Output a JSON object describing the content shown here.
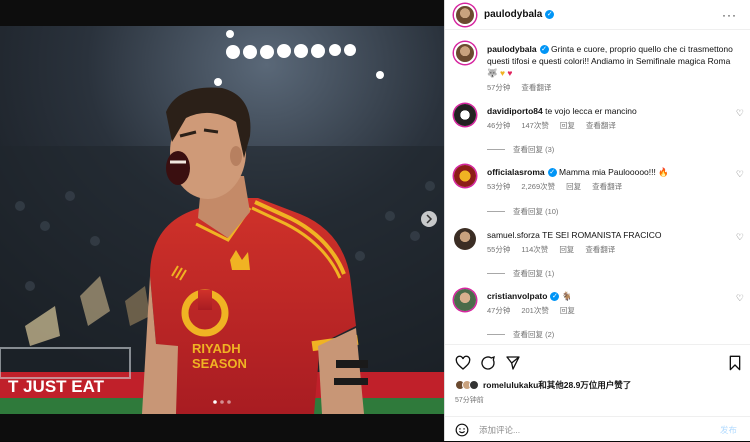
{
  "header": {
    "username": "paulodybala",
    "more_label": "···"
  },
  "caption": {
    "username": "paulodybala",
    "text": "Grinta e cuore, proprio quello che ci trasmettono questi tifosi e questi colori!! Andiamo in Semifinale magica Roma",
    "time": "57分钟",
    "translate": "查看翻译"
  },
  "comments": [
    {
      "username": "davidiporto84",
      "text": "te vojo lecca er mancino",
      "time": "46分钟",
      "likes": "147次赞",
      "reply": "回复",
      "translate": "查看翻译",
      "replies": "查看回复 (3)"
    },
    {
      "username": "officialasroma",
      "text": "Mamma mia Paulooooo!!! 🔥",
      "time": "53分钟",
      "likes": "2,269次赞",
      "reply": "回复",
      "translate": "查看翻译",
      "replies": "查看回复 (10)"
    },
    {
      "username": "samuel.sforza",
      "text": "TE SEI ROMANISTA FRACICO",
      "time": "55分钟",
      "likes": "114次赞",
      "reply": "回复",
      "translate": "查看翻译",
      "replies": "查看回复 (1)"
    },
    {
      "username": "cristianvolpato",
      "text": "🐐",
      "time": "47分钟",
      "likes": "201次赞",
      "reply": "回复",
      "translate": "",
      "replies": "查看回复 (2)"
    }
  ],
  "likes": {
    "text": "romelulukaku和其他28.9万位用户赞了",
    "time": "57分钟前"
  },
  "add_comment": {
    "placeholder": "添加评论...",
    "post_label": "发布"
  },
  "photo": {
    "jersey_text_1": "RIYADH",
    "jersey_text_2": "SEASON",
    "ad_text": "T JUST EAT"
  },
  "colors": {
    "jersey_red": "#c8102e",
    "jersey_gold": "#f0b323",
    "link_blue": "#0095f6"
  }
}
